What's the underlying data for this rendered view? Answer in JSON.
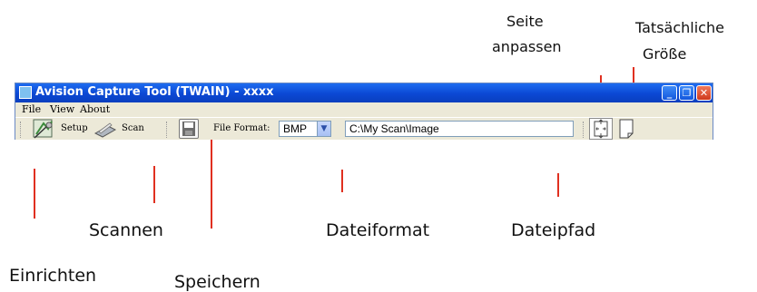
{
  "window": {
    "title": "Avision Capture Tool (TWAIN) - xxxx",
    "controls": {
      "minimize": "_",
      "maximize": "❐",
      "close": "✕"
    }
  },
  "menu": {
    "file": "File",
    "view": "View",
    "about": "About"
  },
  "toolbar": {
    "setup_label": "Setup",
    "scan_label": "Scan",
    "file_format_label": "File Format:",
    "file_format_value": "BMP",
    "file_path_value": "C:\\My Scan\\Image"
  },
  "callouts": {
    "fit_page_line1": "Seite",
    "fit_page_line2": "anpassen",
    "actual_size_line1": "Tatsächliche",
    "actual_size_line2": "Größe",
    "scan": "Scannen",
    "file_format": "Dateiformat",
    "file_path": "Dateipfad",
    "setup": "Einrichten",
    "save": "Speichern"
  },
  "colors": {
    "callout_line": "#e03020",
    "titlebar": "#0b48d4",
    "toolbar_bg": "#ece9d8"
  }
}
